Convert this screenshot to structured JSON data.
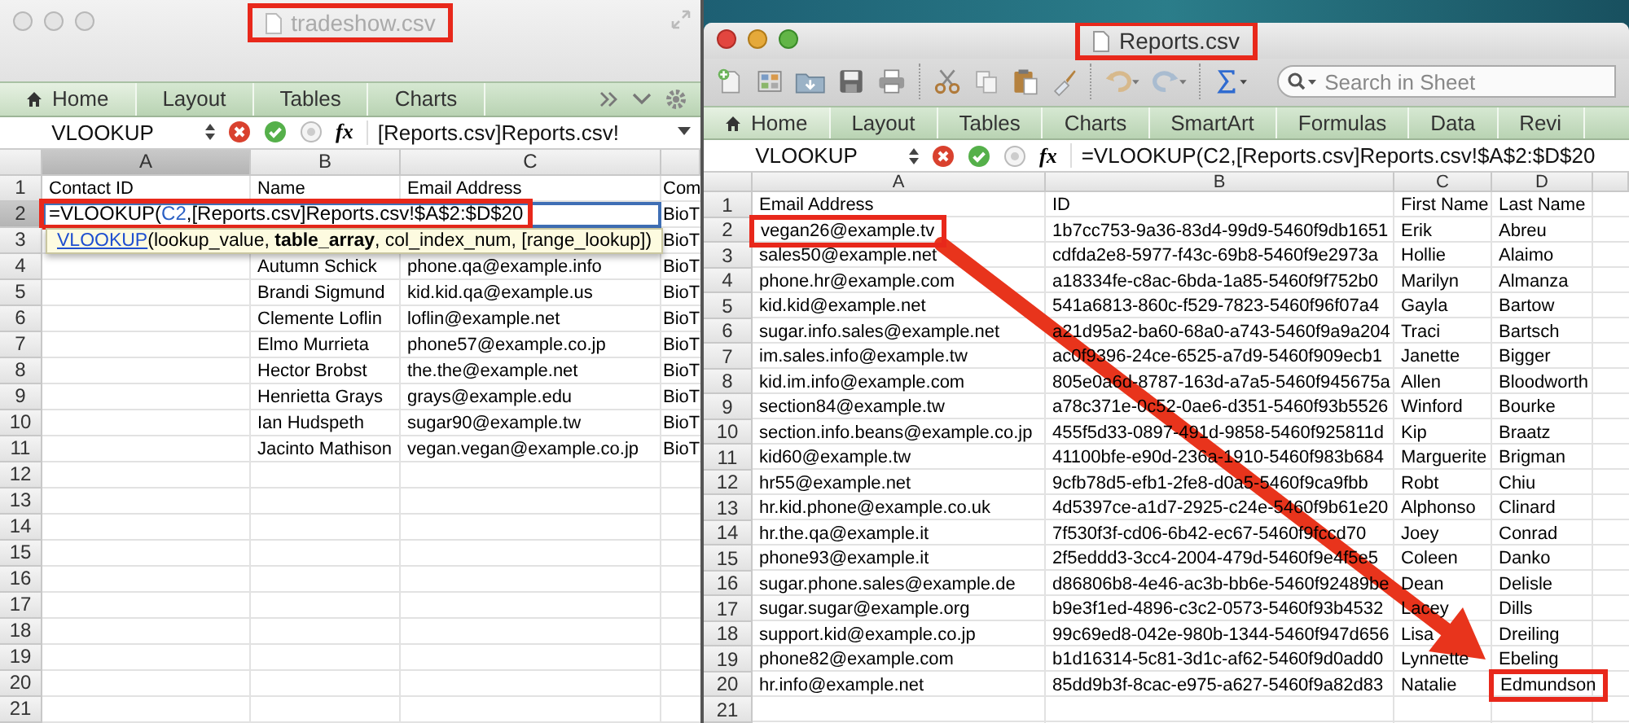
{
  "left_window": {
    "title": "tradeshow.csv",
    "active": false,
    "title_marked": true,
    "tabs": [
      {
        "label": "Home",
        "selected": true
      },
      {
        "label": "Layout",
        "selected": false
      },
      {
        "label": "Tables",
        "selected": false
      },
      {
        "label": "Charts",
        "selected": false
      }
    ],
    "name_box": "VLOOKUP",
    "fx_label": "fx",
    "formula": "[Reports.csv]Reports.csv!",
    "columns": [
      {
        "label": "A",
        "selected": true
      },
      {
        "label": "B",
        "selected": false
      },
      {
        "label": "C",
        "selected": false
      }
    ],
    "rows": [
      {
        "num": "1",
        "selected": false,
        "a": "Contact ID",
        "b": "Name",
        "c": "Email Address",
        "d": "Com"
      },
      {
        "num": "2",
        "selected": true,
        "editing": {
          "marked": true,
          "parts": [
            {
              "kind": "plain",
              "text": "=VLOOKUP("
            },
            {
              "kind": "ref",
              "text": "C2"
            },
            {
              "kind": "plain",
              "text": ",[Reports.csv]Reports.csv!$A$2:$D$20"
            }
          ]
        },
        "d": "BioT"
      },
      {
        "num": "3",
        "selected": false,
        "tooltip": {
          "link": "VLOOKUP",
          "rest": "(lookup_value, **table_array**, col_index_num, [range_lookup])"
        },
        "d": "BioT"
      },
      {
        "num": "4",
        "selected": false,
        "b": "Autumn Schick",
        "c": "phone.qa@example.info",
        "d": "BioT"
      },
      {
        "num": "5",
        "selected": false,
        "b": "Brandi Sigmund",
        "c": "kid.kid.qa@example.us",
        "d": "BioT"
      },
      {
        "num": "6",
        "selected": false,
        "b": "Clemente Loflin",
        "c": "loflin@example.net",
        "d": "BioT"
      },
      {
        "num": "7",
        "selected": false,
        "b": "Elmo Murrieta",
        "c": "phone57@example.co.jp",
        "d": "BioT"
      },
      {
        "num": "8",
        "selected": false,
        "b": "Hector Brobst",
        "c": "the.the@example.net",
        "d": "BioT"
      },
      {
        "num": "9",
        "selected": false,
        "b": "Henrietta Grays",
        "c": "grays@example.edu",
        "d": "BioT"
      },
      {
        "num": "10",
        "selected": false,
        "b": "Ian Hudspeth",
        "c": "sugar90@example.tw",
        "d": "BioT"
      },
      {
        "num": "11",
        "selected": false,
        "b": "Jacinto Mathison",
        "c": "vegan.vegan@example.co.jp",
        "d": "BioT"
      },
      {
        "num": "12",
        "selected": false
      },
      {
        "num": "13",
        "selected": false
      },
      {
        "num": "14",
        "selected": false
      },
      {
        "num": "15",
        "selected": false
      },
      {
        "num": "16",
        "selected": false
      },
      {
        "num": "17",
        "selected": false
      },
      {
        "num": "18",
        "selected": false
      },
      {
        "num": "19",
        "selected": false
      },
      {
        "num": "20",
        "selected": false
      },
      {
        "num": "21",
        "selected": false
      }
    ]
  },
  "right_window": {
    "title": "Reports.csv",
    "active": true,
    "title_marked": true,
    "search": {
      "placeholder": "Search in Sheet"
    },
    "tabs": [
      {
        "label": "Home",
        "selected": true
      },
      {
        "label": "Layout",
        "selected": false
      },
      {
        "label": "Tables",
        "selected": false
      },
      {
        "label": "Charts",
        "selected": false
      },
      {
        "label": "SmartArt",
        "selected": false
      },
      {
        "label": "Formulas",
        "selected": false
      },
      {
        "label": "Data",
        "selected": false
      },
      {
        "label": "Revi",
        "selected": false
      }
    ],
    "name_box": "VLOOKUP",
    "fx_label": "fx",
    "formula": "=VLOOKUP(C2,[Reports.csv]Reports.csv!$A$2:$D$20",
    "columns": [
      "A",
      "B",
      "C",
      "D"
    ],
    "rows": [
      {
        "num": "1",
        "cells": [
          "Email Address",
          "ID",
          "First Name",
          "Last Name"
        ]
      },
      {
        "num": "2",
        "cells": [
          {
            "text": "vegan26@example.tv",
            "marked": true
          },
          "1b7cc753-9a36-83d4-99d9-5460f9db1651",
          "Erik",
          "Abreu"
        ]
      },
      {
        "num": "3",
        "cells": [
          "sales50@example.net",
          "cdfda2e8-5977-f43c-69b8-5460f9e2973a",
          "Hollie",
          "Alaimo"
        ]
      },
      {
        "num": "4",
        "cells": [
          "phone.hr@example.com",
          "a18334fe-c8ac-6bda-1a85-5460f9f752b0",
          "Marilyn",
          "Almanza"
        ]
      },
      {
        "num": "5",
        "cells": [
          "kid.kid@example.net",
          "541a6813-860c-f529-7823-5460f96f07a4",
          "Gayla",
          "Bartow"
        ]
      },
      {
        "num": "6",
        "cells": [
          "sugar.info.sales@example.net",
          "a21d95a2-ba60-68a0-a743-5460f9a9a204",
          "Traci",
          "Bartsch"
        ]
      },
      {
        "num": "7",
        "cells": [
          "im.sales.info@example.tw",
          "ac0f9396-24ce-6525-a7d9-5460f909ecb1",
          "Janette",
          "Bigger"
        ]
      },
      {
        "num": "8",
        "cells": [
          "kid.im.info@example.com",
          "805e0a6d-8787-163d-a7a5-5460f945675a",
          "Allen",
          "Bloodworth"
        ]
      },
      {
        "num": "9",
        "cells": [
          "section84@example.tw",
          "a78c371e-0c52-0ae6-d351-5460f93b5526",
          "Winford",
          "Bourke"
        ]
      },
      {
        "num": "10",
        "cells": [
          "section.info.beans@example.co.jp",
          "455f5d33-0897-491d-9858-5460f925811d",
          "Kip",
          "Braatz"
        ]
      },
      {
        "num": "11",
        "cells": [
          "kid60@example.tw",
          "41100bfe-e90d-236a-1910-5460f983b684",
          "Marguerite",
          "Brigman"
        ]
      },
      {
        "num": "12",
        "cells": [
          "hr55@example.net",
          "9cfb78d5-efb1-2fe8-d0a5-5460f9ca9fbb",
          "Robt",
          "Chiu"
        ]
      },
      {
        "num": "13",
        "cells": [
          "hr.kid.phone@example.co.uk",
          "4d5397ce-a1d7-2925-c24e-5460f9b61e20",
          "Alphonso",
          "Clinard"
        ]
      },
      {
        "num": "14",
        "cells": [
          "hr.the.qa@example.it",
          "7f530f3f-cd06-6b42-ec67-5460f9fccd70",
          "Joey",
          "Conrad"
        ]
      },
      {
        "num": "15",
        "cells": [
          "phone93@example.it",
          "2f5eddd3-3cc4-2004-479d-5460f9e4f5e5",
          "Coleen",
          "Danko"
        ]
      },
      {
        "num": "16",
        "cells": [
          "sugar.phone.sales@example.de",
          "d86806b8-4e46-ac3b-bb6e-5460f92489be",
          "Dean",
          "Delisle"
        ]
      },
      {
        "num": "17",
        "cells": [
          "sugar.sugar@example.org",
          "b9e3f1ed-4896-c3c2-0573-5460f93b4532",
          "Lacey",
          "Dills"
        ]
      },
      {
        "num": "18",
        "cells": [
          "support.kid@example.co.jp",
          "99c69ed8-042e-980b-1344-5460f947d656",
          "Lisa",
          "Dreiling"
        ]
      },
      {
        "num": "19",
        "cells": [
          "phone82@example.com",
          "b1d16314-5c81-3d1c-af62-5460f9d0add0",
          "Lynnette",
          "Ebeling"
        ]
      },
      {
        "num": "20",
        "cells": [
          "hr.info@example.net",
          "85dd9b3f-8cac-e975-a627-5460f9a82d83",
          "Natalie",
          {
            "text": "Edmundson",
            "marked": true
          }
        ]
      },
      {
        "num": "21",
        "cells": []
      }
    ]
  },
  "annotation_arrow": true
}
